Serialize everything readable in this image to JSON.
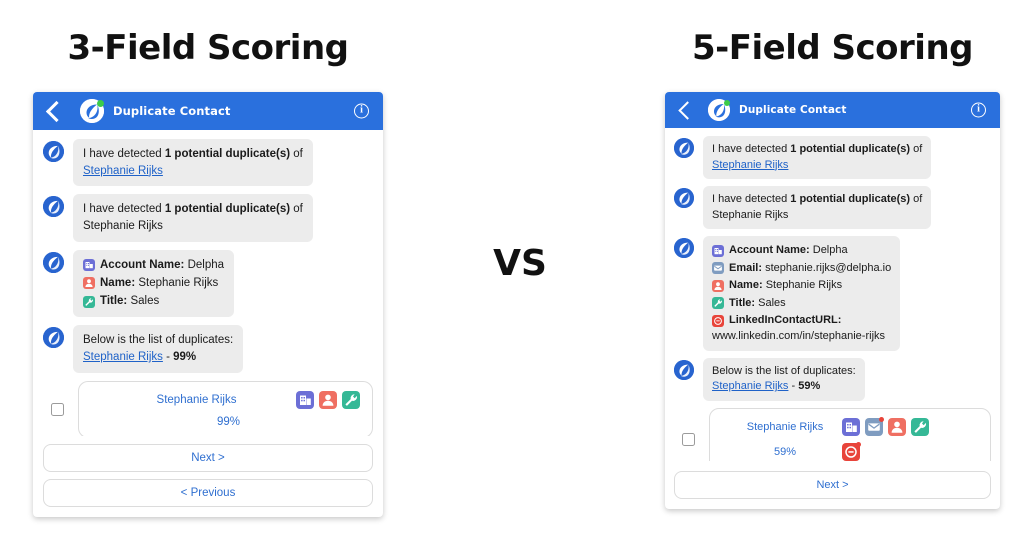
{
  "headings": {
    "left": "3-Field Scoring",
    "right": "5-Field Scoring"
  },
  "vs_label": "VS",
  "colors": {
    "topbar_blue": "#2a70dd",
    "link_blue": "#1f62c8",
    "bubble_gray": "#ececec",
    "account_icon": "#6c6fd6",
    "email_icon": "#7f9cc0",
    "name_icon": "#ef6f62",
    "title_icon": "#35b896",
    "linkedin_icon": "#e8443a",
    "logo_green_dot": "#3ccc4a"
  },
  "panels": [
    {
      "id": "three-field",
      "topbar": {
        "back_icon": "back-chevron-icon",
        "logo_icon": "delpha-logo-icon",
        "title": "Duplicate Contact",
        "info_icon": "info-icon",
        "info_glyph": "i"
      },
      "messages": [
        {
          "kind": "text-with-link",
          "prefix": "I have detected ",
          "bold": "1 potential duplicate(s)",
          "suffix": " of",
          "link": "Stephanie Rijks"
        },
        {
          "kind": "text-plain",
          "prefix": "I have detected ",
          "bold": "1 potential duplicate(s)",
          "suffix": " of",
          "plain": "Stephanie Rijks"
        },
        {
          "kind": "fields",
          "fields": [
            {
              "icon": "account-icon",
              "label": "Account Name:",
              "value": "Delpha"
            },
            {
              "icon": "name-icon",
              "label": "Name:",
              "value": "Stephanie Rijks"
            },
            {
              "icon": "title-icon",
              "label": "Title:",
              "value": "Sales"
            }
          ]
        },
        {
          "kind": "duplicates-list",
          "heading": "Below is the list of duplicates:",
          "link": "Stephanie Rijks",
          "separator": " - ",
          "score": "99%"
        }
      ],
      "card": {
        "checkbox_checked": false,
        "name": "Stephanie Rijks",
        "score": "99%",
        "badges_top": [
          "account-icon",
          "name-icon",
          "title-icon"
        ],
        "badges_bottom": []
      },
      "buttons": [
        "Next >",
        "< Previous"
      ]
    },
    {
      "id": "five-field",
      "topbar": {
        "back_icon": "back-chevron-icon",
        "logo_icon": "delpha-logo-icon",
        "title": "Duplicate Contact",
        "info_icon": "info-icon",
        "info_glyph": "i"
      },
      "messages": [
        {
          "kind": "text-with-link",
          "prefix": "I have detected ",
          "bold": "1 potential duplicate(s)",
          "suffix": " of",
          "link": "Stephanie Rijks"
        },
        {
          "kind": "text-plain",
          "prefix": "I have detected ",
          "bold": "1 potential duplicate(s)",
          "suffix": " of",
          "plain": "Stephanie Rijks"
        },
        {
          "kind": "fields",
          "fields": [
            {
              "icon": "account-icon",
              "label": "Account Name:",
              "value": "Delpha"
            },
            {
              "icon": "email-icon",
              "label": "Email:",
              "value": "stephanie.rijks@delpha.io"
            },
            {
              "icon": "name-icon",
              "label": "Name:",
              "value": "Stephanie Rijks"
            },
            {
              "icon": "title-icon",
              "label": "Title:",
              "value": "Sales"
            },
            {
              "icon": "linkedin-icon",
              "label": "LinkedInContactURL:",
              "value": ""
            }
          ],
          "trailing_value": "www.linkedin.com/in/stephanie-rijks"
        },
        {
          "kind": "duplicates-list",
          "heading": "Below is the list of duplicates:",
          "link": "Stephanie Rijks",
          "separator": " - ",
          "score": "59%"
        }
      ],
      "card": {
        "checkbox_checked": false,
        "name": "Stephanie Rijks",
        "score": "59%",
        "badges_top": [
          "account-icon",
          "email-icon",
          "name-icon",
          "title-icon"
        ],
        "badges_bottom": [
          "linkedin-icon"
        ]
      },
      "buttons": [
        "Next >"
      ]
    }
  ]
}
